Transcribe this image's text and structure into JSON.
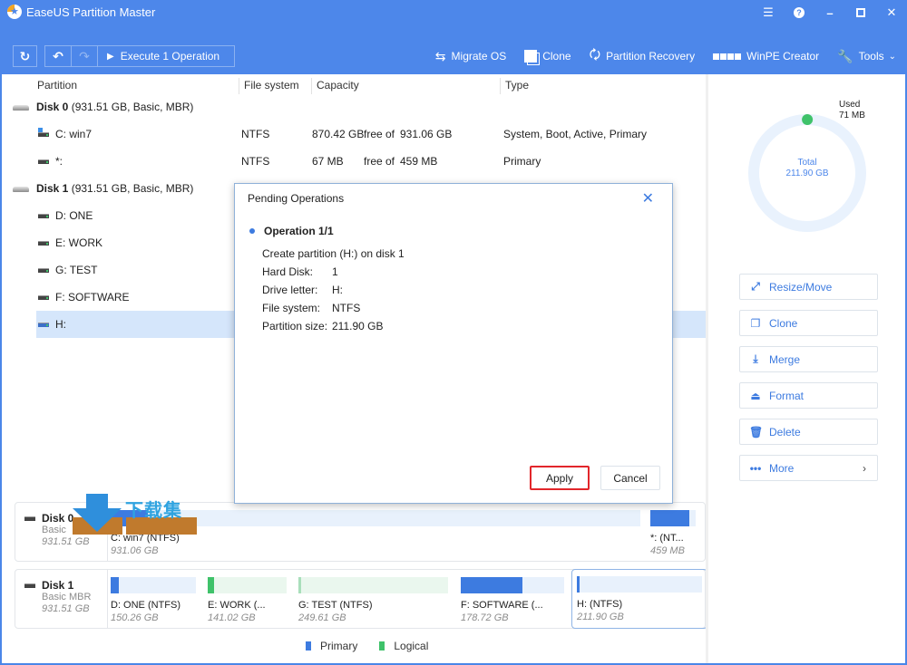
{
  "window": {
    "title": "EaseUS Partition Master",
    "controls": [
      "menu",
      "help",
      "minimize",
      "maximize",
      "close"
    ]
  },
  "toolbar": {
    "refresh_icon": "refresh-icon",
    "undo_icon": "undo-icon",
    "redo_icon": "redo-icon",
    "execute_label": "Execute 1 Operation",
    "tools": [
      {
        "label": "Migrate OS",
        "icon": "migrate-icon"
      },
      {
        "label": "Clone",
        "icon": "clone-icon"
      },
      {
        "label": "Partition Recovery",
        "icon": "partition-recovery-icon"
      },
      {
        "label": "WinPE Creator",
        "icon": "windows-icon"
      },
      {
        "label": "Tools",
        "icon": "wrench-icon"
      }
    ]
  },
  "table": {
    "headers": [
      "Partition",
      "File system",
      "Capacity",
      "Type"
    ],
    "disks": [
      {
        "name": "Disk 0",
        "info": "(931.51 GB, Basic, MBR)",
        "partitions": [
          {
            "name": "C: win7",
            "fs": "NTFS",
            "free": "870.42 GB",
            "free_of": "free of",
            "total": "931.06 GB",
            "type": "System, Boot, Active, Primary"
          },
          {
            "name": "*:",
            "fs": "NTFS",
            "free": "67 MB",
            "free_of": "free of",
            "total": "459 MB",
            "type": "Primary"
          }
        ]
      },
      {
        "name": "Disk 1",
        "info": "(931.51 GB, Basic, MBR)",
        "partitions": [
          {
            "name": "D: ONE"
          },
          {
            "name": "E: WORK"
          },
          {
            "name": "G: TEST"
          },
          {
            "name": "F: SOFTWARE"
          },
          {
            "name": "H:",
            "selected": true
          }
        ]
      }
    ]
  },
  "disk_map": {
    "disks": [
      {
        "name": "Disk 0",
        "type": "Basic",
        "size": "931.51 GB",
        "segments": [
          {
            "name": "C: win7 (NTFS)",
            "size": "931.06 GB",
            "used_fraction": 0.07,
            "kind": "primary"
          },
          {
            "name": "*:  (NT...",
            "size": "459 MB",
            "used_fraction": 0.85,
            "kind": "primary"
          }
        ]
      },
      {
        "name": "Disk 1",
        "type": "Basic MBR",
        "size": "931.51 GB",
        "segments": [
          {
            "name": "D: ONE (NTFS)",
            "size": "150.26 GB",
            "used_fraction": 0.1,
            "kind": "primary"
          },
          {
            "name": "E: WORK (...",
            "size": "141.02 GB",
            "used_fraction": 0.08,
            "kind": "logical"
          },
          {
            "name": "G: TEST (NTFS)",
            "size": "249.61 GB",
            "used_fraction": 0.01,
            "kind": "logical"
          },
          {
            "name": "F: SOFTWARE (...",
            "size": "178.72 GB",
            "used_fraction": 0.6,
            "kind": "primary"
          },
          {
            "name": "H:  (NTFS)",
            "size": "211.90 GB",
            "used_fraction": 0.003,
            "kind": "primary",
            "selected": true
          }
        ]
      }
    ],
    "legend": [
      {
        "label": "Primary",
        "color": "#3d7be0"
      },
      {
        "label": "Logical",
        "color": "#3fc26a"
      }
    ]
  },
  "side_panel": {
    "used_label": "Used",
    "used_value": "71 MB",
    "total_label": "Total",
    "total_value": "211.90 GB",
    "used_fraction": 0.0003,
    "actions": [
      {
        "label": "Resize/Move",
        "icon": "resize-icon"
      },
      {
        "label": "Clone",
        "icon": "clone-icon"
      },
      {
        "label": "Merge",
        "icon": "merge-icon"
      },
      {
        "label": "Format",
        "icon": "format-icon"
      },
      {
        "label": "Delete",
        "icon": "delete-icon"
      },
      {
        "label": "More",
        "icon": "more-icon"
      }
    ]
  },
  "dialog": {
    "title": "Pending Operations",
    "operation_heading": "Operation 1/1",
    "description": "Create partition (H:) on disk 1",
    "details": [
      {
        "key": "Hard Disk:",
        "value": "1"
      },
      {
        "key": "Drive letter:",
        "value": "H:"
      },
      {
        "key": "File system:",
        "value": "NTFS"
      },
      {
        "key": "Partition size:",
        "value": "211.90 GB"
      }
    ],
    "apply_label": "Apply",
    "cancel_label": "Cancel"
  },
  "watermark": {
    "text": "下载集"
  },
  "colors": {
    "accent": "#4d87ea",
    "primary": "#3d7be0",
    "logical": "#3fc26a",
    "selection": "#d5e6fb",
    "highlight_border": "#e2262b"
  }
}
